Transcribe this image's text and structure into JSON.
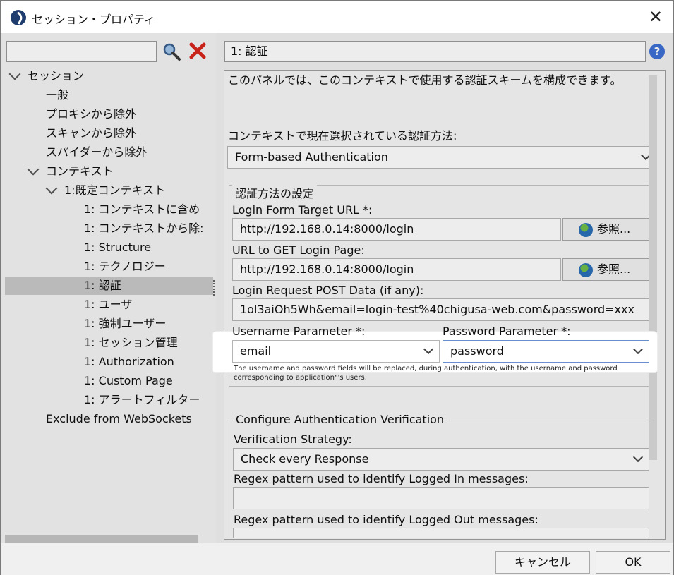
{
  "window": {
    "title": "セッション・プロパティ"
  },
  "left": {
    "search_placeholder": "",
    "tree": [
      {
        "label": "セッション",
        "level": 0,
        "expanded": true
      },
      {
        "label": "一般",
        "level": 1
      },
      {
        "label": "プロキシから除外",
        "level": 1
      },
      {
        "label": "スキャンから除外",
        "level": 1
      },
      {
        "label": "スパイダーから除外",
        "level": 1
      },
      {
        "label": "コンテキスト",
        "level": 1,
        "expanded": true
      },
      {
        "label": "1:既定コンテキスト",
        "level": 2,
        "expanded": true
      },
      {
        "label": "1: コンテキストに含め",
        "level": 3
      },
      {
        "label": "1: コンテキストから除:",
        "level": 3
      },
      {
        "label": "1: Structure",
        "level": 3
      },
      {
        "label": "1: テクノロジー",
        "level": 3
      },
      {
        "label": "1: 認証",
        "level": 3,
        "selected": true
      },
      {
        "label": "1: ユーザ",
        "level": 3
      },
      {
        "label": "1: 強制ユーザー",
        "level": 3
      },
      {
        "label": "1: セッション管理",
        "level": 3
      },
      {
        "label": "1: Authorization",
        "level": 3
      },
      {
        "label": "1: Custom Page",
        "level": 3
      },
      {
        "label": "1: アラートフィルター",
        "level": 3
      },
      {
        "label": "Exclude from WebSockets",
        "level": 1
      }
    ]
  },
  "panel": {
    "title": "1: 認証",
    "description": "このパネルでは、このコンテキストで使用する認証スキームを構成できます。",
    "method_label": "コンテキストで現在選択されている認証方法:",
    "method_value": "Form-based Authentication",
    "settings_group": "認証方法の設定",
    "login_target_label": "Login Form Target URL *:",
    "login_target_value": "http://192.168.0.14:8000/login",
    "browse_label": "参照...",
    "get_login_label": "URL to GET Login Page:",
    "get_login_value": "http://192.168.0.14:8000/login",
    "post_data_label": "Login Request POST Data (if any):",
    "post_data_value": "1ol3aiOh5Wh&email=login-test%40chigusa-web.com&password=xxx",
    "username_param_label": "Username Parameter *:",
    "username_param_value": "email",
    "password_param_label": "Password Parameter *:",
    "password_param_value": "password",
    "note_line1": "The username and password fields will be replaced, during authentication, with the username and password",
    "note_line2": "corresponding to application\"'s users.",
    "verification_group": "Configure Authentication Verification",
    "strategy_label": "Verification Strategy:",
    "strategy_value": "Check every Response",
    "logged_in_label": "Regex pattern used to identify Logged In messages:",
    "logged_out_label": "Regex pattern used to identify Logged Out messages:"
  },
  "buttons": {
    "cancel": "キャンセル",
    "ok": "OK"
  }
}
